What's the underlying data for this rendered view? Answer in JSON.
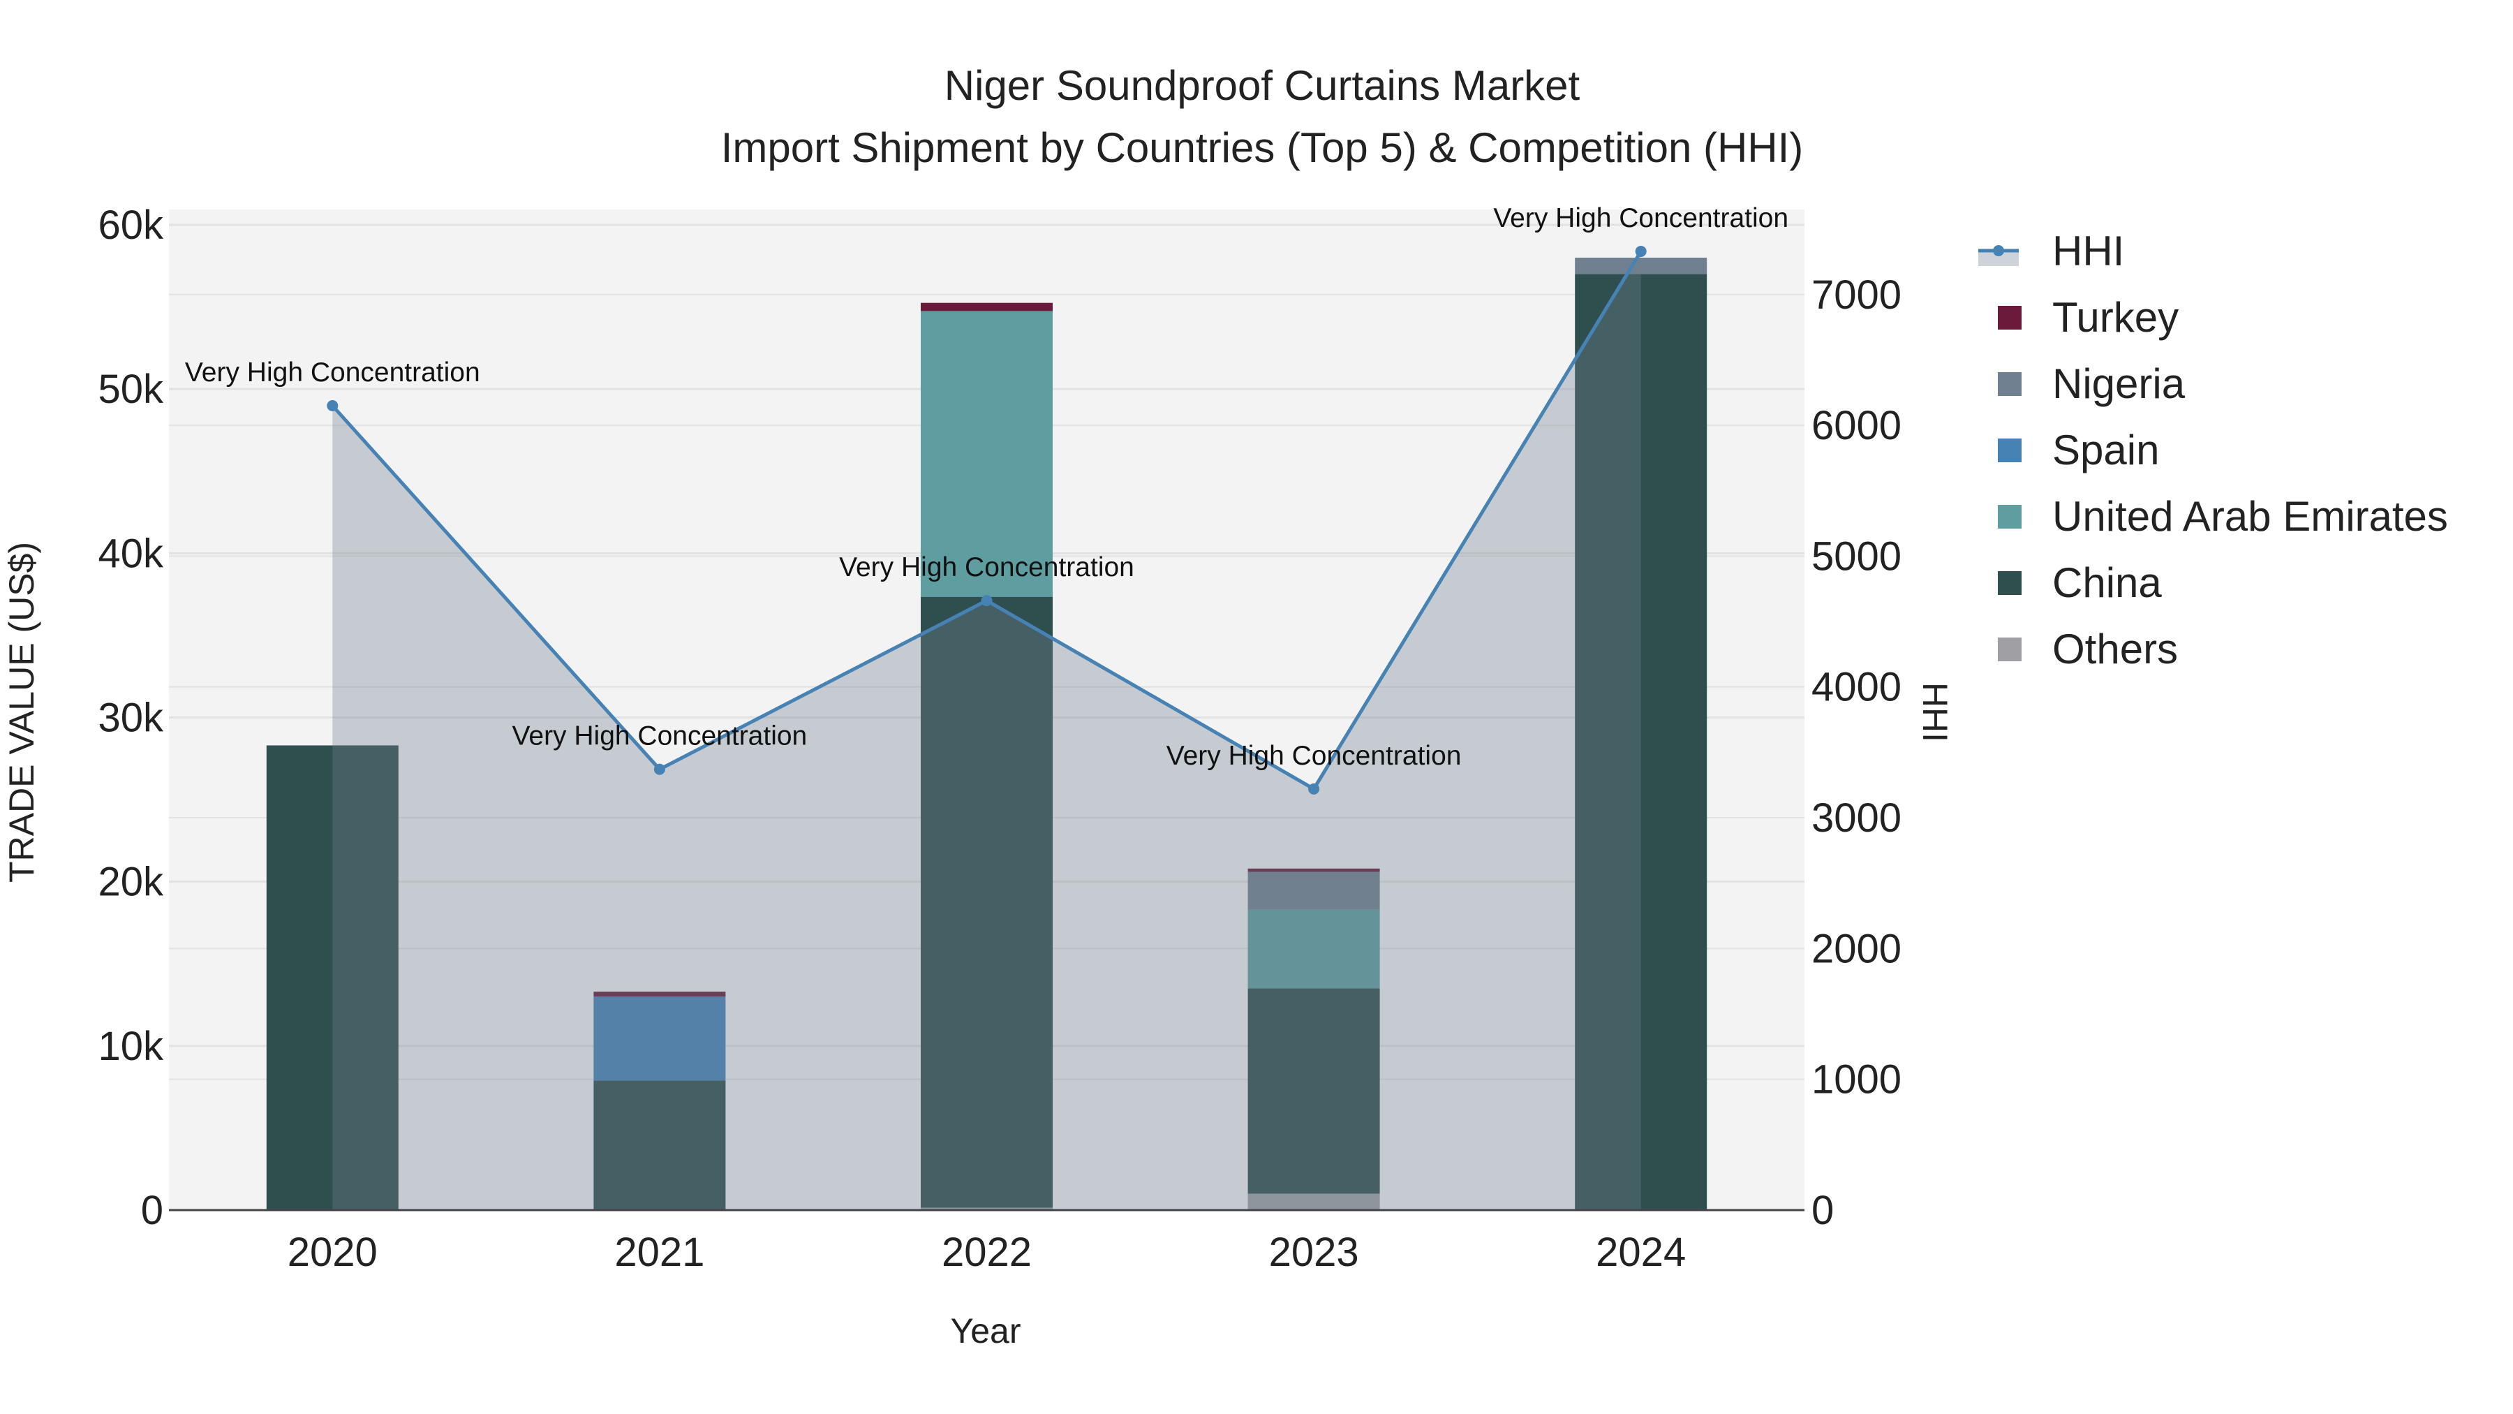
{
  "chart_data": {
    "type": "bar",
    "title": "Niger Soundproof Curtains Market",
    "subtitle": "Import Shipment by Countries (Top 5) & Competition (HHI)",
    "xlabel": "Year",
    "ylabel": "TRADE VALUE (US$)",
    "y2label": "HHI",
    "categories": [
      "2020",
      "2021",
      "2022",
      "2023",
      "2024"
    ],
    "ylim": [
      0,
      60000
    ],
    "y_ticks": [
      0,
      10000,
      20000,
      30000,
      40000,
      50000,
      60000
    ],
    "y_tick_labels": [
      "0",
      "10k",
      "20k",
      "30k",
      "40k",
      "50k",
      "60k"
    ],
    "y2lim": [
      0,
      7650
    ],
    "y2_ticks": [
      0,
      1000,
      2000,
      3000,
      4000,
      5000,
      6000,
      7000
    ],
    "y2_tick_labels": [
      "0",
      "1000",
      "2000",
      "3000",
      "4000",
      "5000",
      "6000",
      "7000"
    ],
    "grid": true,
    "legend_position": "right",
    "series": [
      {
        "name": "Others",
        "color": "#a0a0a4",
        "values": [
          0,
          0,
          150,
          1000,
          0
        ]
      },
      {
        "name": "China",
        "color": "#2f4f4f",
        "values": [
          28300,
          7900,
          37200,
          12500,
          57000
        ]
      },
      {
        "name": "United Arab Emirates",
        "color": "#5f9ea0",
        "values": [
          0,
          0,
          17400,
          4800,
          0
        ]
      },
      {
        "name": "Spain",
        "color": "#4682b4",
        "values": [
          0,
          5100,
          0,
          0,
          0
        ]
      },
      {
        "name": "Nigeria",
        "color": "#708090",
        "values": [
          0,
          0,
          0,
          2300,
          1000
        ]
      },
      {
        "name": "Turkey",
        "color": "#6b1a3c",
        "values": [
          0,
          300,
          500,
          200,
          0
        ]
      }
    ],
    "hhi": {
      "name": "HHI",
      "color": "#4682b4",
      "values": [
        6150,
        3370,
        4660,
        3220,
        7330
      ],
      "annotations": [
        "Very High Concentration",
        "Very High Concentration",
        "Very High Concentration",
        "Very High Concentration",
        "Very High Concentration"
      ]
    },
    "legend_order": [
      "HHI",
      "Turkey",
      "Nigeria",
      "Spain",
      "United Arab Emirates",
      "China",
      "Others"
    ]
  }
}
